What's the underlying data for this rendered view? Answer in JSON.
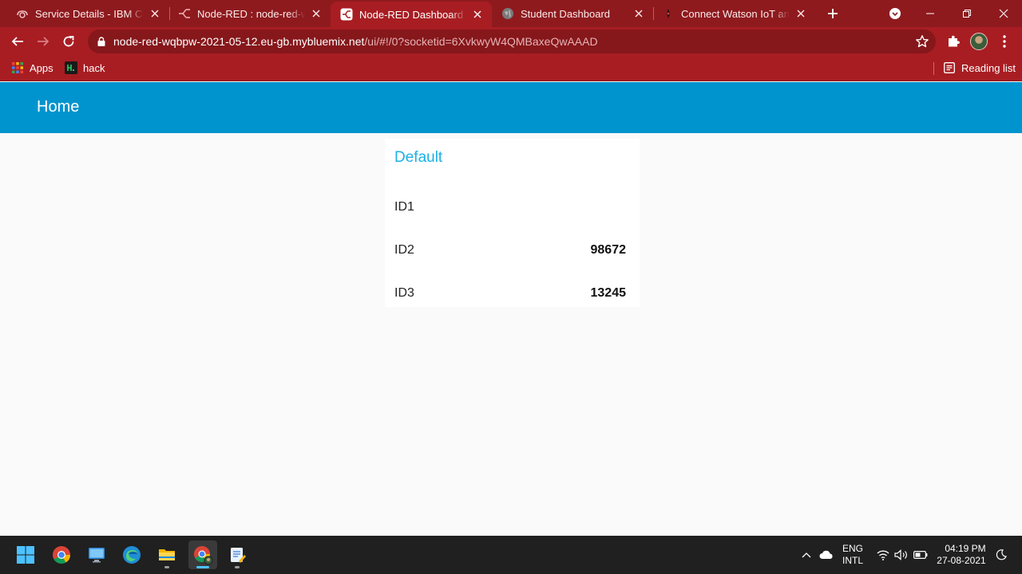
{
  "browser": {
    "tabs": [
      {
        "title": "Service Details - IBM Cloud",
        "favicon": "ibm-cloud-icon",
        "active": false
      },
      {
        "title": "Node-RED : node-red-wqbpw",
        "favicon": "node-red-icon",
        "active": false
      },
      {
        "title": "Node-RED Dashboard",
        "favicon": "node-red-dashboard-icon",
        "active": true
      },
      {
        "title": "Student Dashboard",
        "favicon": "globe-icon",
        "active": false
      },
      {
        "title": "Connect Watson IoT and Node-RED",
        "favicon": "watson-icon",
        "active": false
      }
    ],
    "address": {
      "host": "node-red-wqbpw-2021-05-12.eu-gb.mybluemix.net",
      "path": "/ui/#!/0?socketid=6XvkwyW4QMBaxeQwAAAD"
    },
    "bookmarks": [
      {
        "label": "Apps",
        "icon": "apps-grid-icon"
      },
      {
        "label": "hack",
        "icon": "hackerrank-icon"
      }
    ],
    "reading_list": "Reading list",
    "colors": {
      "frame": "#8e1a1e",
      "toolbar": "#a81d22",
      "omnibox": "#86171b"
    }
  },
  "dashboard": {
    "title": "Home",
    "header_color": "#0094ce",
    "group": {
      "title": "Default",
      "title_color": "#1bb0e5",
      "rows": [
        {
          "label": "ID1",
          "value": ""
        },
        {
          "label": "ID2",
          "value": "98672"
        },
        {
          "label": "ID3",
          "value": "13245"
        }
      ]
    }
  },
  "taskbar": {
    "apps": [
      "windows-start-icon",
      "chrome-icon",
      "desktop-icon",
      "edge-icon",
      "file-explorer-icon",
      "chrome-profile-icon",
      "notepad-icon"
    ],
    "language": {
      "line1": "ENG",
      "line2": "INTL"
    },
    "time": "04:19 PM",
    "date": "27-08-2021"
  }
}
